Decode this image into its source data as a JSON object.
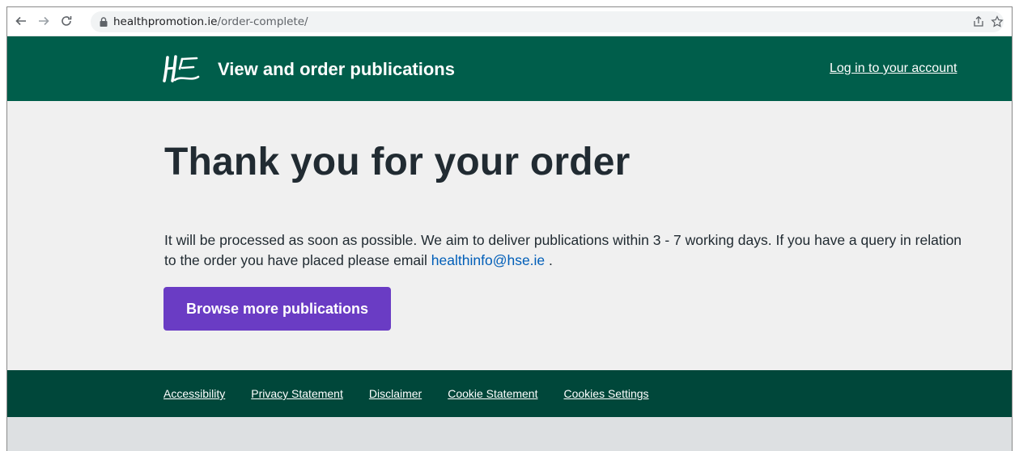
{
  "browser": {
    "url_host": "healthpromotion.ie",
    "url_path": "/order-complete/"
  },
  "header": {
    "title": "View and order publications",
    "login_link": "Log in to your account"
  },
  "main": {
    "heading": "Thank you for your order",
    "message": "It will be processed as soon as possible. We aim to deliver publications within 3 - 7 working days. If you have a query in relation to the order you have placed please email ",
    "email_link": "healthinfo@hse.ie",
    "message_end": " .",
    "browse_button": "Browse more publications"
  },
  "footer": {
    "links": [
      "Accessibility",
      "Privacy Statement",
      "Disclaimer",
      "Cookie Statement",
      "Cookies Settings"
    ]
  },
  "colors": {
    "header_bg": "#005e4b",
    "footer_bg": "#00473a",
    "button_bg": "#6a3cc4",
    "link": "#005eb8"
  }
}
